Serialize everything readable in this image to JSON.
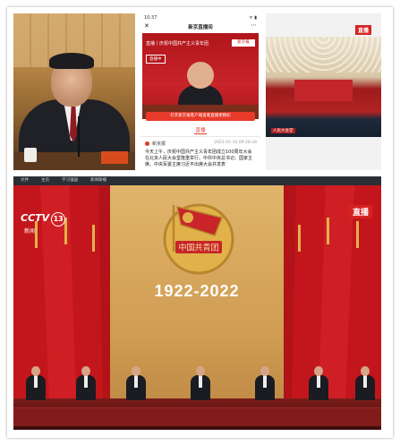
{
  "panel_phone": {
    "status_time": "10:37",
    "status_icons": "ᯤ ▮",
    "app_title": "新京直播间",
    "close_glyph": "✕",
    "menu_glyph": "⋯",
    "video_title": "直播丨庆祝中国共产主义青年团",
    "video_logo": "新京报",
    "live_tag": "直播中",
    "open_button": "打开新京报客户端查看直播更精彩",
    "tab_label": "直播",
    "source": "新京报",
    "date": "2022-05-10 09:28:28",
    "body_text": "今天上午，庆祝中国共产主义青年团成立100周年大会在北京人民大会堂隆重举行。中共中央总书记、国家主席、中央军委主席习近平出席大会并发表"
  },
  "panel_hall": {
    "live_badge": "直播",
    "caption": "人民大会堂"
  },
  "panel_broadcast": {
    "topbar_items": [
      "文件",
      "主页",
      "学习强国",
      "新闻联播"
    ],
    "channel_logo": "CCTV",
    "channel_number": "13",
    "channel_sub": "新闻",
    "live_badge": "直播",
    "emblem_text": "中国共青团",
    "years": "1922-2022"
  },
  "colors": {
    "party_red": "#c8242a",
    "gold": "#e2b24a",
    "live_red": "#d82222"
  }
}
